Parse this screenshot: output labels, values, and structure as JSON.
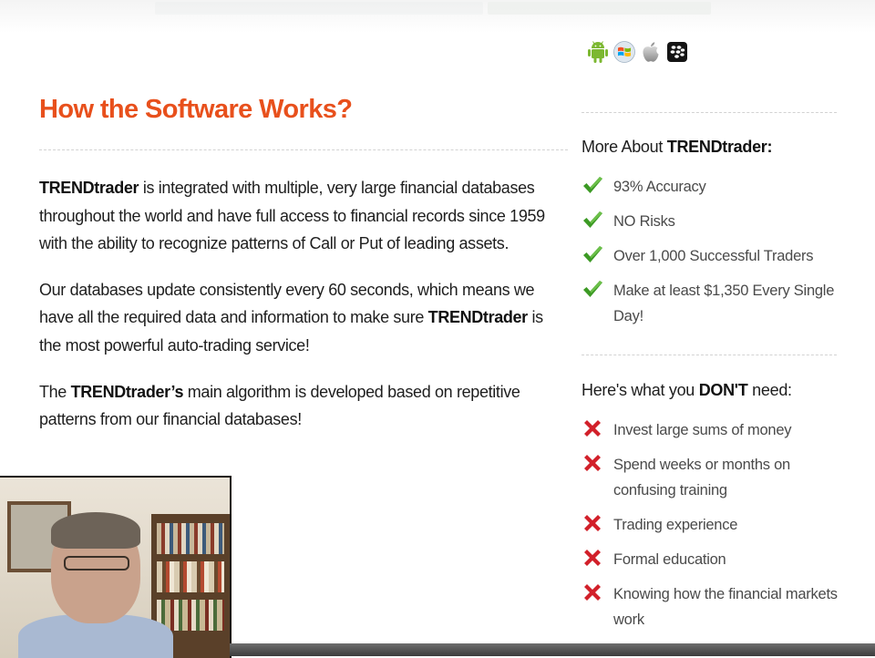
{
  "main": {
    "title": "How the Software Works?",
    "paragraphs": [
      {
        "pre": "",
        "bold": "TRENDtrader",
        "post": " is integrated with multiple, very large financial databases throughout the world and have full access to financial records since 1959 with the ability to recognize patterns of Call or Put of leading assets."
      },
      {
        "pre": "Our databases update consistently every 60 seconds, which means we have all the required data and information to make sure ",
        "bold": "TRENDtrader",
        "post": " is the most powerful auto-trading service!"
      },
      {
        "pre": "The ",
        "bold": "TRENDtrader’s",
        "post": " main algorithm is developed based on repetitive patterns from our financial databases!"
      }
    ]
  },
  "platforms": [
    "android-icon",
    "windows-icon",
    "apple-icon",
    "blackberry-icon"
  ],
  "sidebar": {
    "more": {
      "heading_pre": "More About ",
      "heading_bold": "TRENDtrader:",
      "heading_post": "",
      "icon": "check-icon",
      "items": [
        "93% Accuracy",
        "NO Risks",
        "Over 1,000 Successful Traders",
        "Make at least $1,350 Every Single Day!"
      ]
    },
    "dont": {
      "heading_pre": "Here's what you ",
      "heading_bold": "DON'T",
      "heading_post": " need:",
      "icon": "x-icon",
      "items": [
        "Invest large sums of money",
        "Spend weeks or months on confusing training",
        "Trading experience",
        "Formal education",
        "Knowing how the financial markets work"
      ]
    }
  },
  "colors": {
    "title": "#e8501c",
    "check": "#3c9a24",
    "cross": "#d2202a"
  }
}
